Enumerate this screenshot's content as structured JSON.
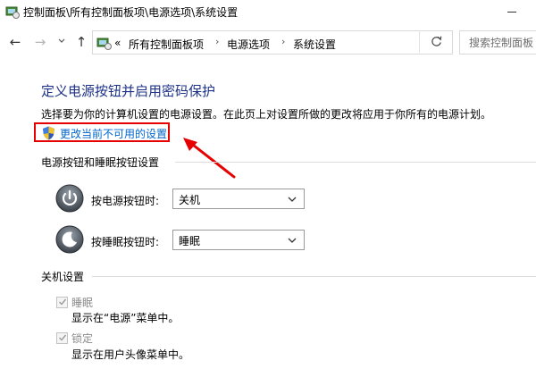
{
  "window": {
    "title": "控制面板\\所有控制面板项\\电源选项\\系统设置"
  },
  "nav": {
    "back_icon": "back-arrow-icon",
    "forward_icon": "forward-arrow-icon",
    "up_icon": "up-arrow-icon",
    "overflow": "«",
    "breadcrumbs": [
      "所有控制面板项",
      "电源选项",
      "系统设置"
    ],
    "search_placeholder": "搜索控制面板"
  },
  "main": {
    "title": "定义电源按钮并启用密码保护",
    "description": "选择要为你的计算机设置的电源设置。在此页上对设置所做的更改将应用于你所有的电源计划。",
    "change_link": "更改当前不可用的设置",
    "colors": {
      "title": "#1e3287",
      "link": "#0066cc",
      "highlight": "#e60000"
    }
  },
  "buttons_section": {
    "heading": "电源按钮和睡眠按钮设置",
    "rows": [
      {
        "label": "按电源按钮时:",
        "value": "关机"
      },
      {
        "label": "按睡眠按钮时:",
        "value": "睡眠"
      }
    ]
  },
  "shutdown_section": {
    "heading": "关机设置",
    "options": [
      {
        "label": "睡眠",
        "checked": true,
        "sub": "显示在“电源”菜单中。"
      },
      {
        "label": "锁定",
        "checked": true,
        "sub": "显示在用户头像菜单中。"
      }
    ]
  }
}
